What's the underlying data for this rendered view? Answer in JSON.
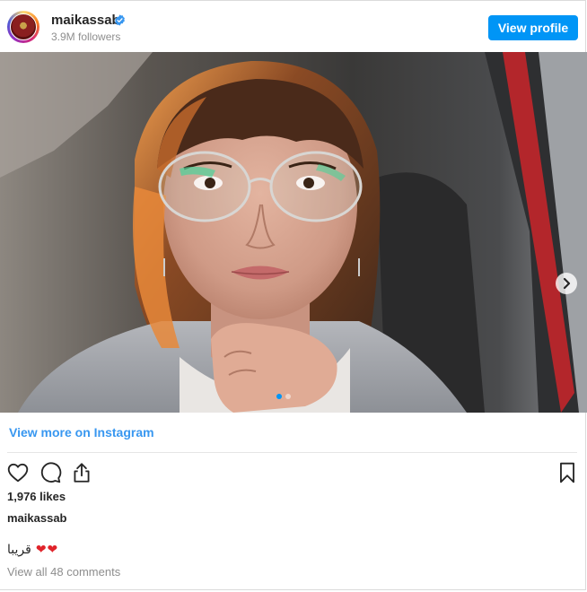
{
  "header": {
    "username": "maikassab",
    "followers": "3.9M followers",
    "view_profile_label": "View profile"
  },
  "post": {
    "image_alt": "Woman with glasses and bangs sitting in a car, hand under chin",
    "carousel": {
      "slide_count": 2,
      "active_index": 0
    },
    "view_more_label": "View more on Instagram",
    "likes": "1,976 likes",
    "caption_username": "maikassab",
    "caption_text": "قريبا",
    "caption_emoji": [
      "❤",
      "❤"
    ],
    "view_comments_label": "View all 48 comments"
  },
  "icons": {
    "verified": "verified-badge-icon",
    "like": "heart-icon",
    "comment": "comment-icon",
    "share": "share-icon",
    "save": "bookmark-icon",
    "next": "chevron-right-icon"
  },
  "colors": {
    "accent": "#0095f6",
    "link": "#3897f0",
    "muted": "#8e8e8e",
    "text": "#262626",
    "heart": "#e0242b"
  }
}
